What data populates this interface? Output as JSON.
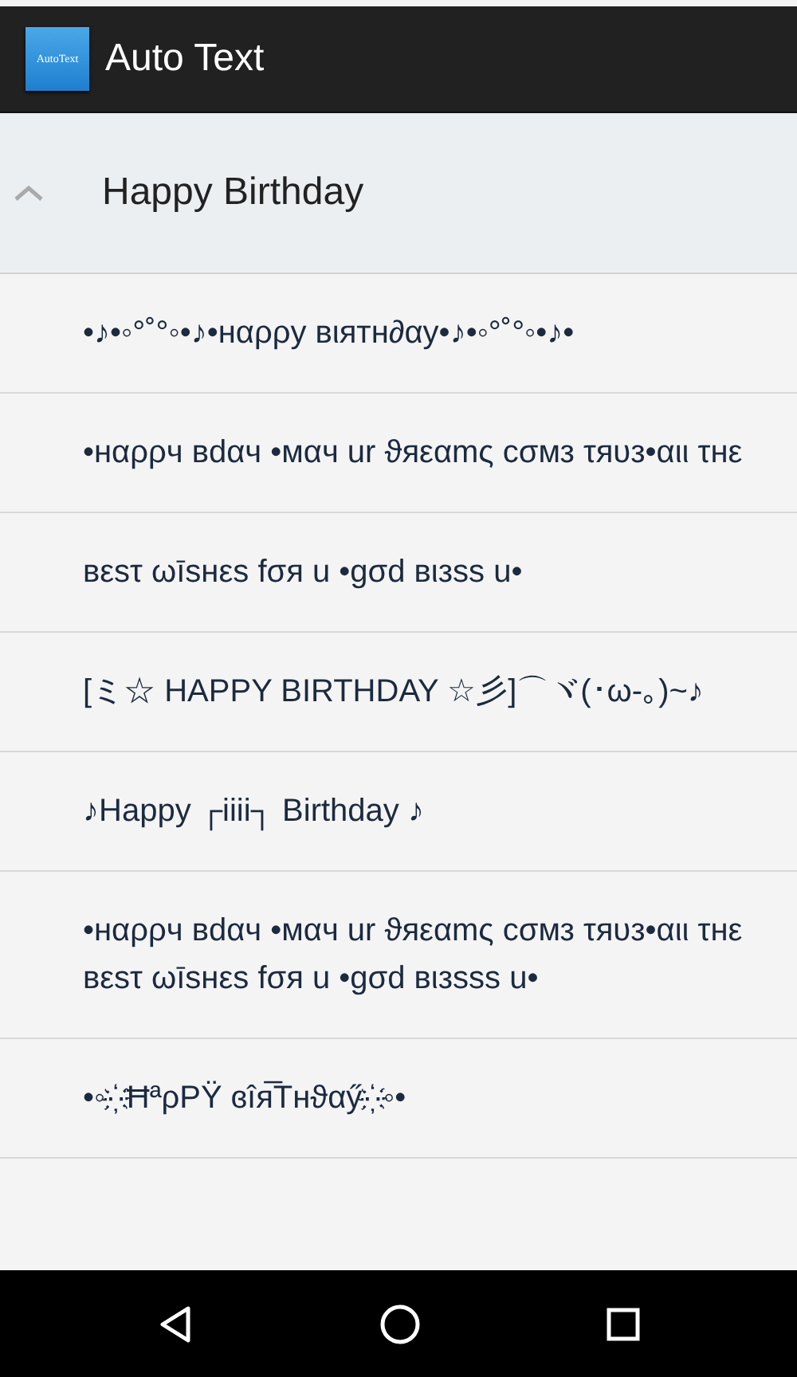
{
  "app_bar": {
    "logo_text": "AutoText",
    "title": "Auto Text"
  },
  "group": {
    "title": "Happy Birthday",
    "expanded": true
  },
  "items": [
    "•♪•◦°˚°◦•♪•нαρρу вιятн∂αу•♪•◦°˚°◦•♪•",
    "•нαρρч вdαч •мαч ur ϑяεαmς cσмз τяυз•αιι τнε",
    "вεsτ ωīsнεs fσя u •gσd вιзss u•",
    "[ミ☆ HAPPY BIRTHDAY ☆彡]⌒ヾ(･ω-｡)~♪",
    "♪Happy ┌iiii┐ Birthday ♪",
    "•нαρρч вdαч •мαч ur ϑяεαmς cσмз τяυз•αιι τнε вεsτ ωīsнεs fσя u •gσd вιзsss u•",
    "•◦·҉·ĦªρΡŸ ɞîя̅Тнϑαӳ·҉·◦•"
  ]
}
